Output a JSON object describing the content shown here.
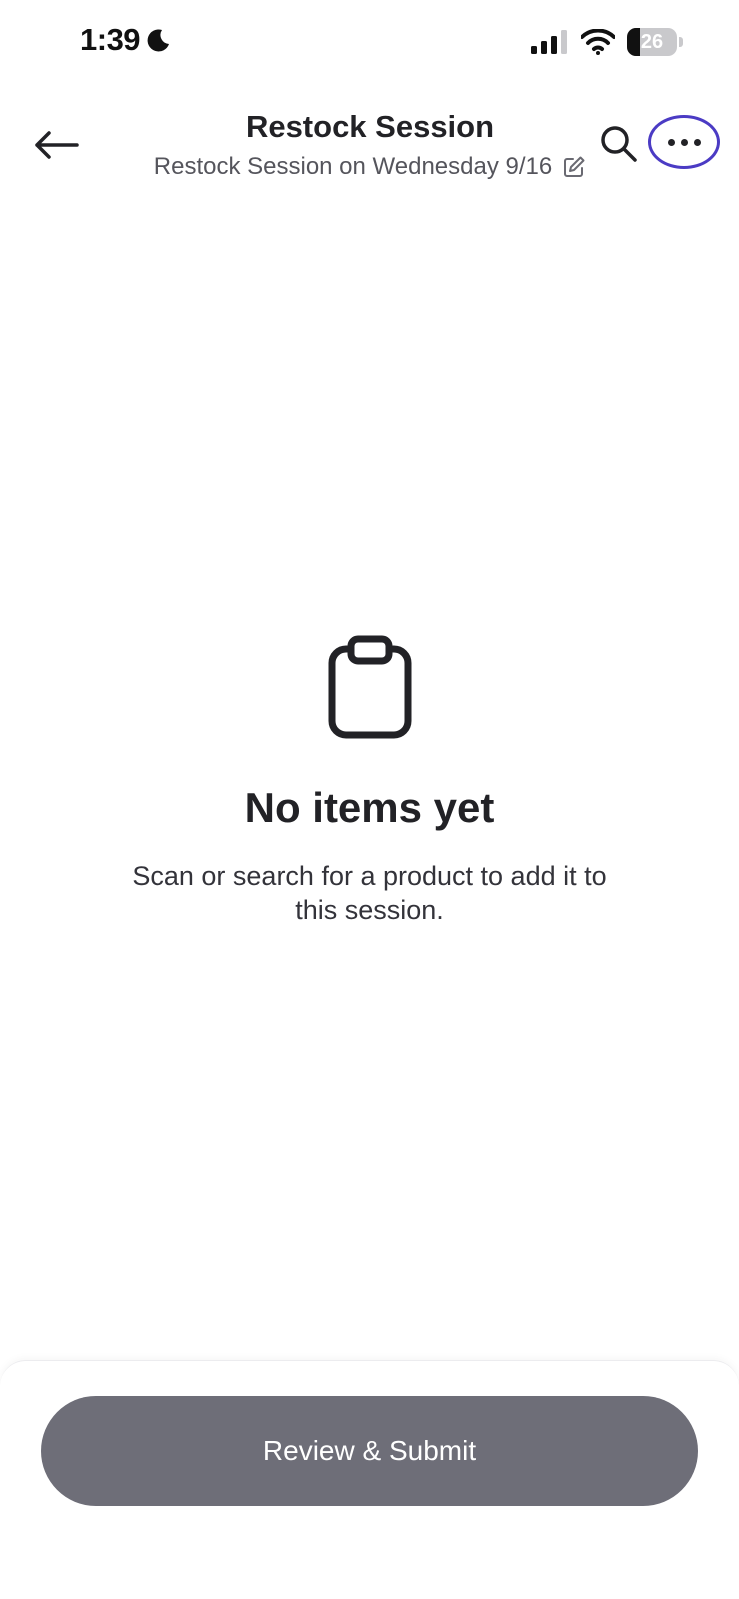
{
  "status_bar": {
    "time": "1:39",
    "battery_level": "26",
    "battery_fraction": 0.26,
    "icons": [
      "moon-icon",
      "cellular-signal-icon",
      "wifi-icon",
      "battery-icon"
    ]
  },
  "header": {
    "title": "Restock Session",
    "subtitle": "Restock Session on Wednesday 9/16",
    "icons": [
      "back-arrow-icon",
      "edit-icon",
      "search-icon",
      "more-icon"
    ],
    "highlight_color": "#4b3bc4"
  },
  "empty_state": {
    "icon": "clipboard-icon",
    "title": "No items yet",
    "message": "Scan or search for a product to add it to this session."
  },
  "footer": {
    "submit_label": "Review & Submit",
    "submit_color": "#6e6e78"
  }
}
